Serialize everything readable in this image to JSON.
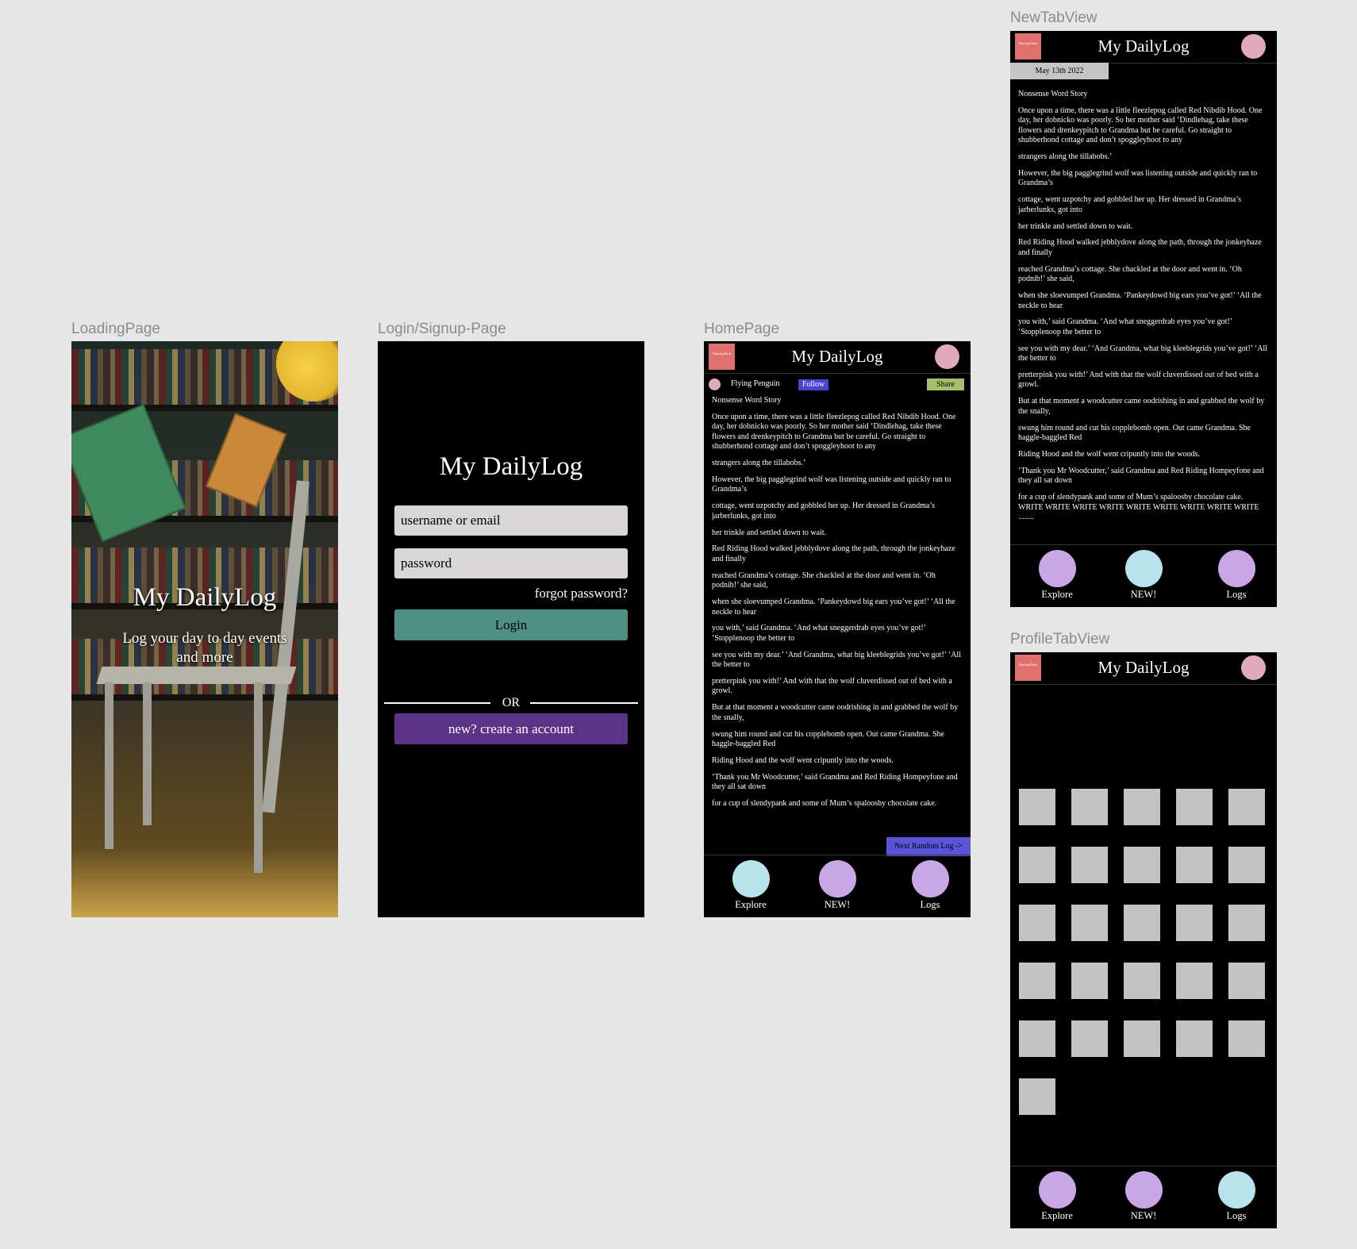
{
  "frames": {
    "loading": "LoadingPage",
    "login": "Login/Signup-Page",
    "home": "HomePage",
    "newtab": "NewTabView",
    "profile": "ProfileTabView"
  },
  "app_title": "My DailyLog",
  "logo_text": "Dancing Duck",
  "loading": {
    "subtitle": "Log your day to day events and more"
  },
  "login": {
    "username_placeholder": "username or email",
    "password_placeholder": "password",
    "forgot": "forgot password?",
    "login_label": "Login",
    "or_label": "OR",
    "create_label": "new? create an account"
  },
  "home": {
    "user_name": "Flying Penguin",
    "follow_label": "Follow",
    "share_label": "Share",
    "next_label": "Next Random Log ->"
  },
  "newtab": {
    "date": "May 13th 2022"
  },
  "story": {
    "title": "Nonsense Word Story",
    "paragraphs": [
      "Once upon a time, there was a little fleezlepog called Red Nibdib Hood. One day, her dobnicko was poorly. So her mother said ‘Dindlehag, take these flowers and drenkeypitch to Grandma but be careful. Go straight to shubberhond cottage and don’t spoggleyhoot to any",
      "strangers along the tillabobs.’",
      "However, the big pagglegrind wolf was listening outside and quickly ran to Grandma’s",
      "cottage, went uzpotchy and gobbled her up. Her dressed in Grandma’s jarberlunks, got into",
      "her trinkle and settled down to wait.",
      "Red Riding Hood walked jebblydove along the path, through the jonkeyhaze and finally",
      "reached Grandma’s cottage. She chackled at the door and went in. ‘Oh podnib!’ she said,",
      "when she sloevumped Grandma. ‘Pankeydowd big ears you’ve got!’ ‘All the neckle to hear",
      "you with,’ said Grandma. ‘And what sneggerdrab eyes you’ve got!’ ‘Stopplenoop the better to",
      "see you with my dear.’ ‘And Grandma, what big kleeblegrids you’ve got!’ ‘All the better to",
      "pretterpink you with!’ And with that the wolf cluverdissed out of bed with a growl.",
      "But at that moment a woodcutter came oodrishing in and grabbed the wolf by the snally,",
      "swung him round and cut his copplebomb open. Out came Grandma. She haggle-baggled Red",
      "Riding Hood and the wolf went cripuntly into the woods.",
      "‘Thank you Mr Woodcutter,’ said Grandma and Red Riding Hompeyfone and they all sat down"
    ],
    "home_end": "for a cup of slendypank and some of Mum’s spaloosby chocolate cake.",
    "newtab_end": "for a cup of slendypank and some of Mum’s spaloosby chocolate cake. WRITE WRITE WRITE WRITE WRITE WRITE WRITE WRITE WRITE ........"
  },
  "nav": [
    {
      "label": "Explore"
    },
    {
      "label": "NEW!"
    },
    {
      "label": "Logs"
    }
  ],
  "colors": {
    "nav_active": "#b9e3ea",
    "nav_inactive": "#c9a6e6",
    "login_button": "#4f8f86",
    "create_button": "#5d3388",
    "follow": "#4a44d6",
    "share": "#a7bf6b",
    "logo": "#e0706e",
    "avatar": "#e1a9bd"
  },
  "profile": {
    "active_tab": "Logs",
    "tile_count": 26
  },
  "home_active_tab": "Explore",
  "newtab_active_tab": "NEW!"
}
